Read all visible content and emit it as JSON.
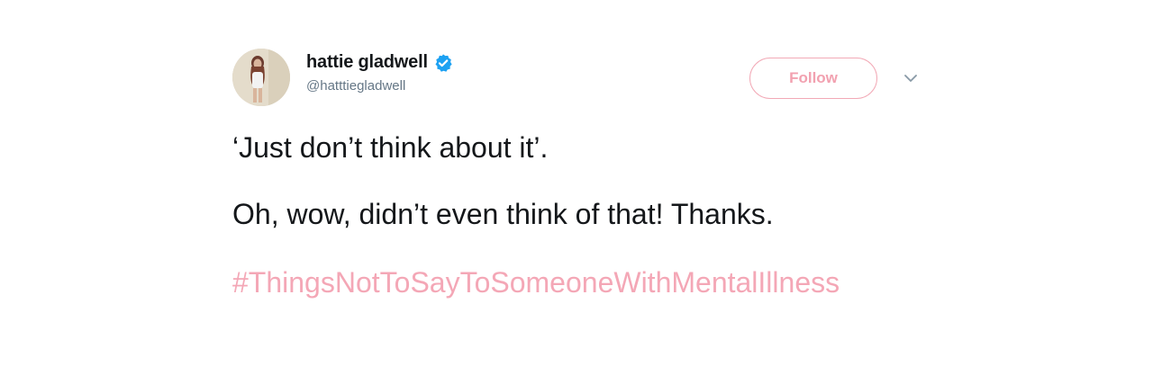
{
  "tweet": {
    "display_name": "hattie gladwell",
    "handle": "@hatttiegladwell",
    "verified": true,
    "follow_label": "Follow",
    "text_line1": "‘Just don’t think about it’.",
    "text_line2": "Oh, wow, didn’t even think of that! Thanks.",
    "hashtag": "#ThingsNotToSayToSomeoneWithMentalIllness"
  },
  "icons": {
    "verified": "verified-badge-icon",
    "caret": "chevron-down-icon"
  },
  "colors": {
    "accent_pink": "#f4a7b6",
    "verified_blue": "#1da1f2",
    "text": "#14171a",
    "secondary_text": "#657786"
  }
}
